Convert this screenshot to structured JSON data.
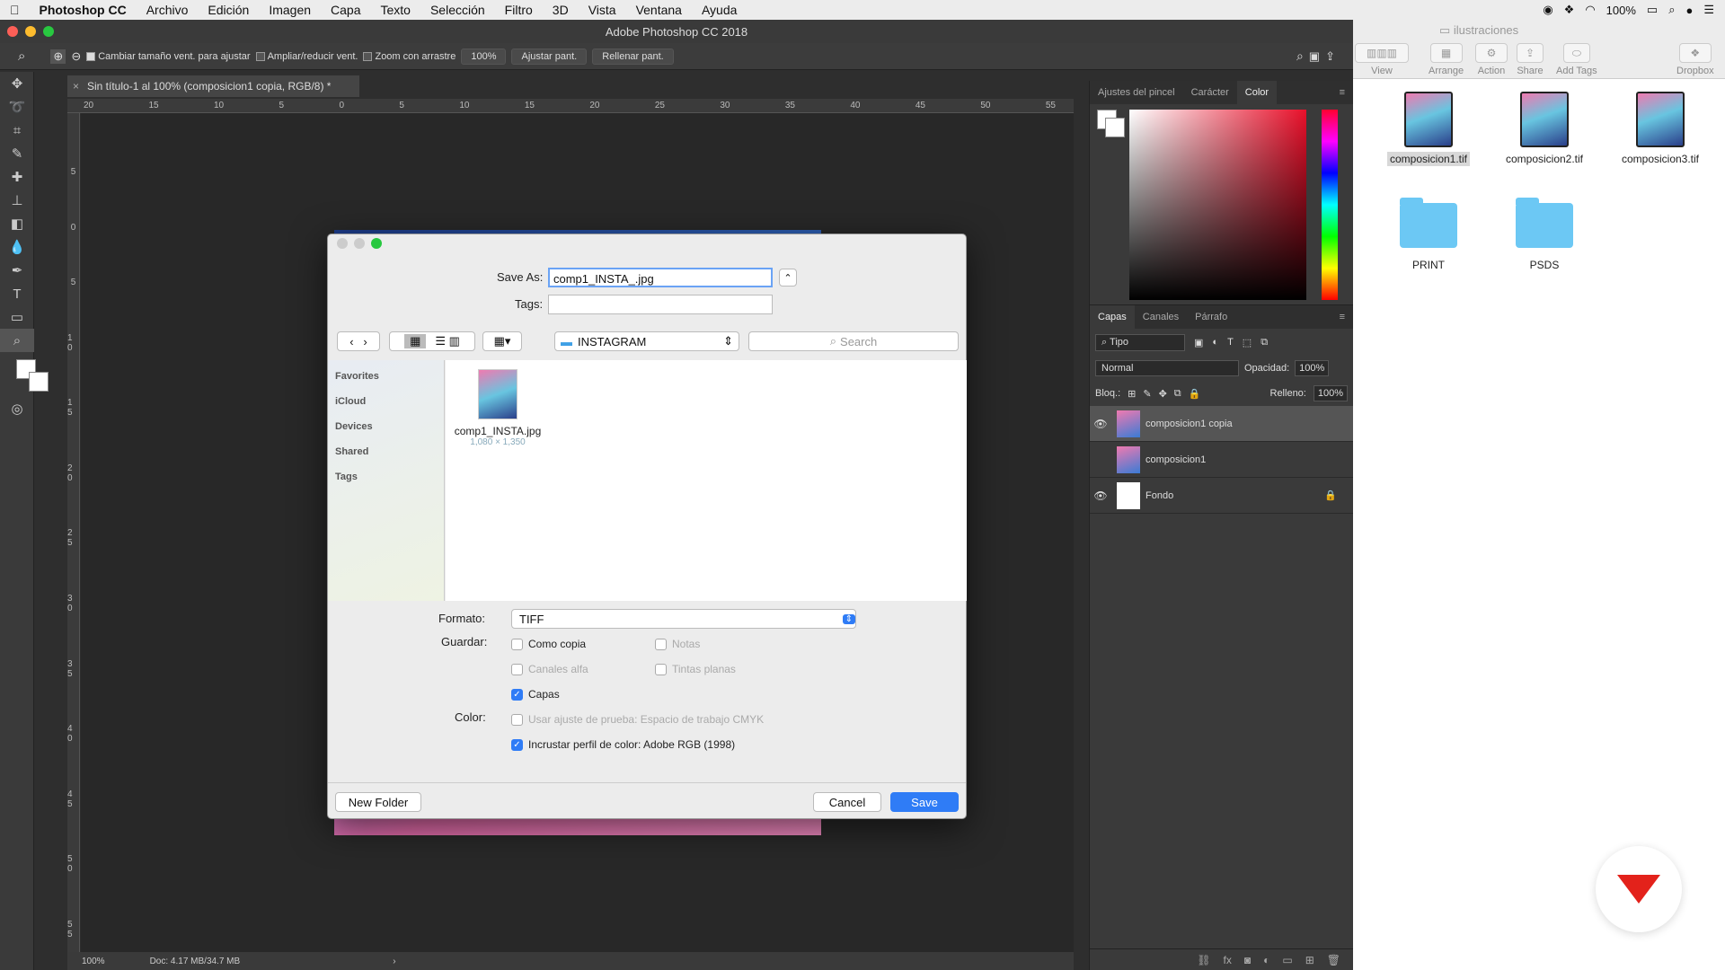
{
  "menubar": {
    "app": "Photoshop CC",
    "items": [
      "Archivo",
      "Edición",
      "Imagen",
      "Capa",
      "Texto",
      "Selección",
      "Filtro",
      "3D",
      "Vista",
      "Ventana",
      "Ayuda"
    ],
    "battery": "100%"
  },
  "ps": {
    "window_title": "Adobe Photoshop CC 2018",
    "options": {
      "resize_label": "Cambiar tamaño vent. para ajustar",
      "zoom_all_label": "Ampliar/reducir vent.",
      "scrubby_label": "Zoom con arrastre",
      "zoom_value": "100%",
      "fit_button": "Ajustar pant.",
      "fill_button": "Rellenar pant."
    },
    "doc_tab": "Sin título-1 al 100% (composicion1 copia, RGB/8) *",
    "ruler_h": [
      "20",
      "15",
      "10",
      "5",
      "0",
      "5",
      "10",
      "15",
      "20",
      "25",
      "30",
      "35",
      "40",
      "45",
      "50",
      "55"
    ],
    "ruler_v": [
      "5",
      "0",
      "5",
      "1 0",
      "1 5",
      "2 0",
      "2 5",
      "3 0",
      "3 5",
      "4 0",
      "4 5",
      "5 0",
      "5 5"
    ],
    "status": {
      "zoom": "100%",
      "doc": "Doc: 4.17 MB/34.7 MB"
    }
  },
  "panels": {
    "top_tabs": [
      "Ajustes del pincel",
      "Carácter",
      "Color"
    ],
    "layer_tabs": [
      "Capas",
      "Canales",
      "Párrafo"
    ],
    "kind_filter": "Tipo",
    "blend_mode": "Normal",
    "opacity_label": "Opacidad:",
    "opacity_value": "100%",
    "lock_label": "Bloq.:",
    "fill_label": "Relleno:",
    "fill_value": "100%",
    "layers": [
      {
        "name": "composicion1 copia",
        "visible": true
      },
      {
        "name": "composicion1",
        "visible": false
      },
      {
        "name": "Fondo",
        "visible": true
      }
    ]
  },
  "finder": {
    "folder_title": "ilustraciones",
    "toolbar": [
      "View",
      "Arrange",
      "Action",
      "Share",
      "Add Tags",
      "Dropbox"
    ],
    "files": [
      "composicion1.tif",
      "composicion2.tif",
      "composicion3.tif"
    ],
    "folders": [
      "PRINT",
      "PSDS"
    ]
  },
  "dialog": {
    "save_as_label": "Save As:",
    "save_as_value": "comp1_INSTA_.jpg",
    "tags_label": "Tags:",
    "location": "INSTAGRAM",
    "search_placeholder": "Search",
    "sidebar": [
      "Favorites",
      "iCloud",
      "Devices",
      "Shared",
      "Tags"
    ],
    "file": {
      "name": "comp1_INSTA.jpg",
      "dims": "1,080 × 1,350"
    },
    "format_label": "Formato:",
    "format_value": "TIFF",
    "save_label": "Guardar:",
    "color_label": "Color:",
    "options": {
      "as_copy": "Como copia",
      "notes": "Notas",
      "alpha": "Canales alfa",
      "spot": "Tintas planas",
      "layers": "Capas",
      "proof": "Usar ajuste de prueba: Espacio de trabajo CMYK",
      "embed": "Incrustar perfil de color: Adobe RGB (1998)"
    },
    "new_folder": "New Folder",
    "cancel": "Cancel",
    "save": "Save"
  }
}
